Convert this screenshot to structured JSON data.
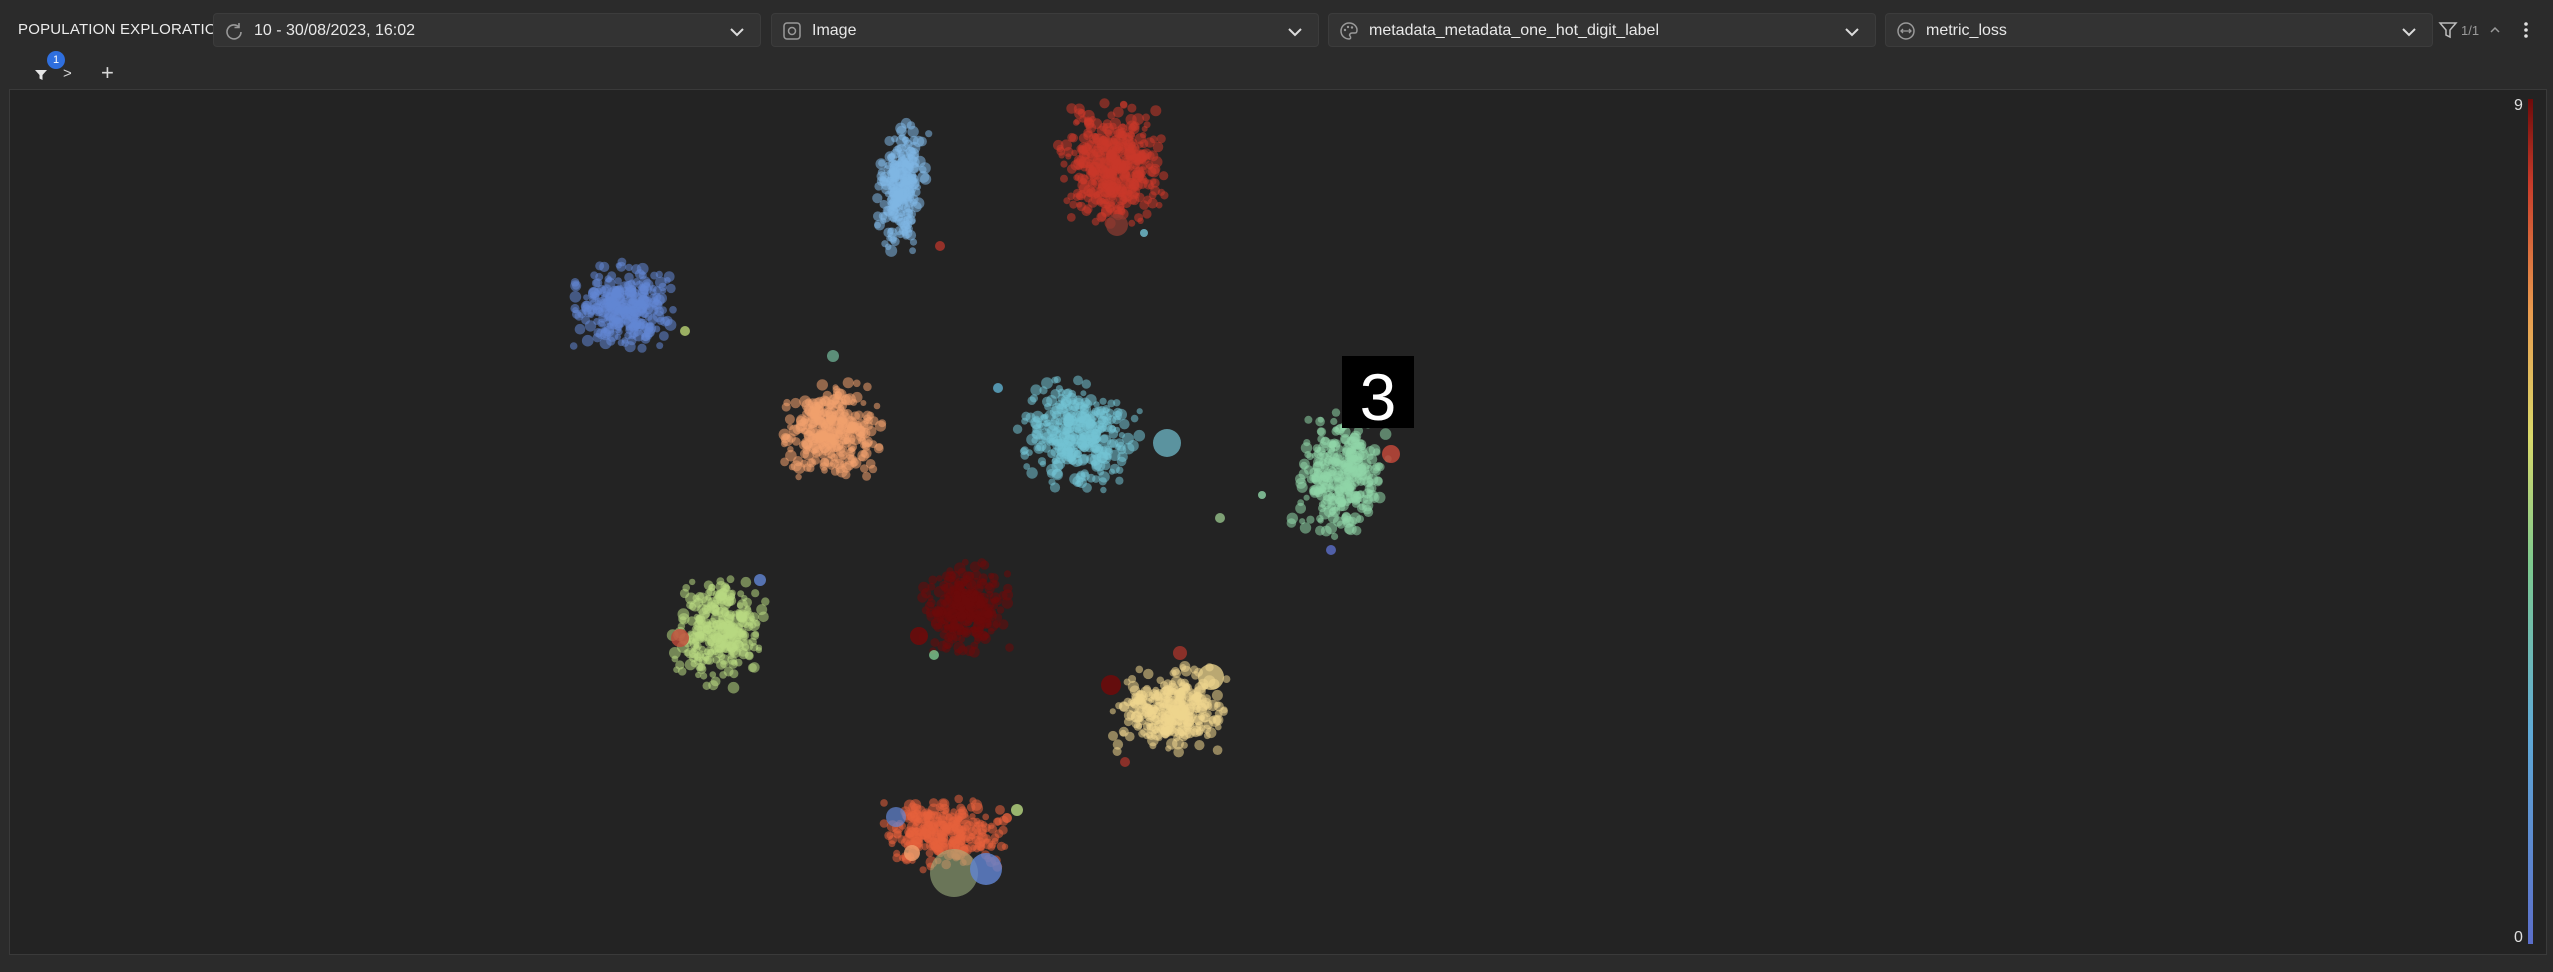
{
  "header": {
    "title": "POPULATION EXPLORATION",
    "filter_count": "1/1"
  },
  "selects": {
    "epoch": "10 - 30/08/2023, 16:02",
    "visualization": "Image",
    "color_by": "metadata_metadata_one_hot_digit_label",
    "size_by": "metric_loss"
  },
  "subbar": {
    "filter_badge": "1",
    "filter_arrow": ">",
    "add": "+"
  },
  "plot": {
    "colorbar_max": "9",
    "colorbar_min": "0",
    "hover_digit": "3",
    "clusters": [
      {
        "name": "cluster-sky-blue",
        "color": "#7fb6e3"
      },
      {
        "name": "cluster-red",
        "color": "#c9382a"
      },
      {
        "name": "cluster-blue",
        "color": "#6286d4"
      },
      {
        "name": "cluster-peach",
        "color": "#f0a06e"
      },
      {
        "name": "cluster-cyan",
        "color": "#73c3d4"
      },
      {
        "name": "cluster-mint",
        "color": "#8fd6a7"
      },
      {
        "name": "cluster-lime",
        "color": "#b8d881"
      },
      {
        "name": "cluster-dark-red",
        "color": "#6b0b0b"
      },
      {
        "name": "cluster-yellow",
        "color": "#eed68e"
      },
      {
        "name": "cluster-orange-red",
        "color": "#e5613d"
      }
    ]
  }
}
